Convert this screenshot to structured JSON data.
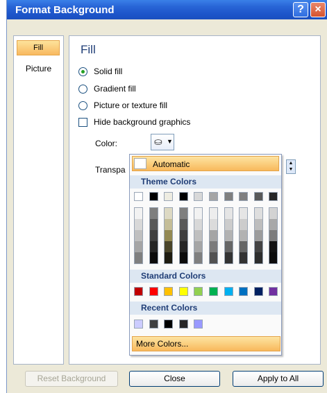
{
  "window": {
    "title": "Format Background",
    "help_label": "?",
    "close_label": "×"
  },
  "nav": {
    "items": [
      {
        "label": "Fill"
      },
      {
        "label": "Picture"
      }
    ]
  },
  "fill": {
    "heading": "Fill",
    "options": [
      {
        "label": "Solid fill",
        "selected": true
      },
      {
        "label": "Gradient fill",
        "selected": false
      },
      {
        "label": "Picture or texture fill",
        "selected": false
      }
    ],
    "hide_graphics_label": "Hide background graphics",
    "color_label": "Color:",
    "transparency_label": "Transpa"
  },
  "color_popup": {
    "automatic_label": "Automatic",
    "theme_header": "Theme Colors",
    "standard_header": "Standard Colors",
    "recent_header": "Recent Colors",
    "more_colors_label": "More Colors...",
    "theme_top": [
      "#ffffff",
      "#000000",
      "#eeece1",
      "#000000",
      "#d8d8d8",
      "#a5a5a5",
      "#7f7f7f",
      "#7f7f7f",
      "#595959",
      "#262626"
    ],
    "theme_columns": [
      [
        "#f2f2f2",
        "#d8d8d8",
        "#bfbfbf",
        "#a5a5a5",
        "#7f7f7f"
      ],
      [
        "#7f7f7f",
        "#595959",
        "#3f3f3f",
        "#262626",
        "#0c0c0c"
      ],
      [
        "#ddd9c3",
        "#c4bd97",
        "#938953",
        "#494429",
        "#1d1b10"
      ],
      [
        "#7f7f7f",
        "#595959",
        "#3f3f3f",
        "#262626",
        "#0c0c0c"
      ],
      [
        "#f2f2f2",
        "#d8d8d8",
        "#bfbfbf",
        "#a5a5a5",
        "#7f7f7f"
      ],
      [
        "#ededed",
        "#dbdbdb",
        "#a5a5a5",
        "#7b7b7b",
        "#525252"
      ],
      [
        "#e5e5e5",
        "#cccccc",
        "#b2b2b2",
        "#666666",
        "#333333"
      ],
      [
        "#e5e5e5",
        "#cccccc",
        "#b2b2b2",
        "#666666",
        "#333333"
      ],
      [
        "#dedede",
        "#bdbdbd",
        "#9c9c9c",
        "#434343",
        "#2d2d2d"
      ],
      [
        "#d3d3d3",
        "#a8a8a8",
        "#7c7c7c",
        "#131313",
        "#0c0c0c"
      ]
    ],
    "standard": [
      "#c00000",
      "#ff0000",
      "#ffc000",
      "#ffff00",
      "#92d050",
      "#00b050",
      "#00b0f0",
      "#0070c0",
      "#002060",
      "#7030a0"
    ],
    "recent": [
      "#ccccff",
      "#404040",
      "#000000",
      "#262626",
      "#9999ff"
    ]
  },
  "buttons": {
    "reset": "Reset Background",
    "close": "Close",
    "apply_all": "Apply to All"
  }
}
